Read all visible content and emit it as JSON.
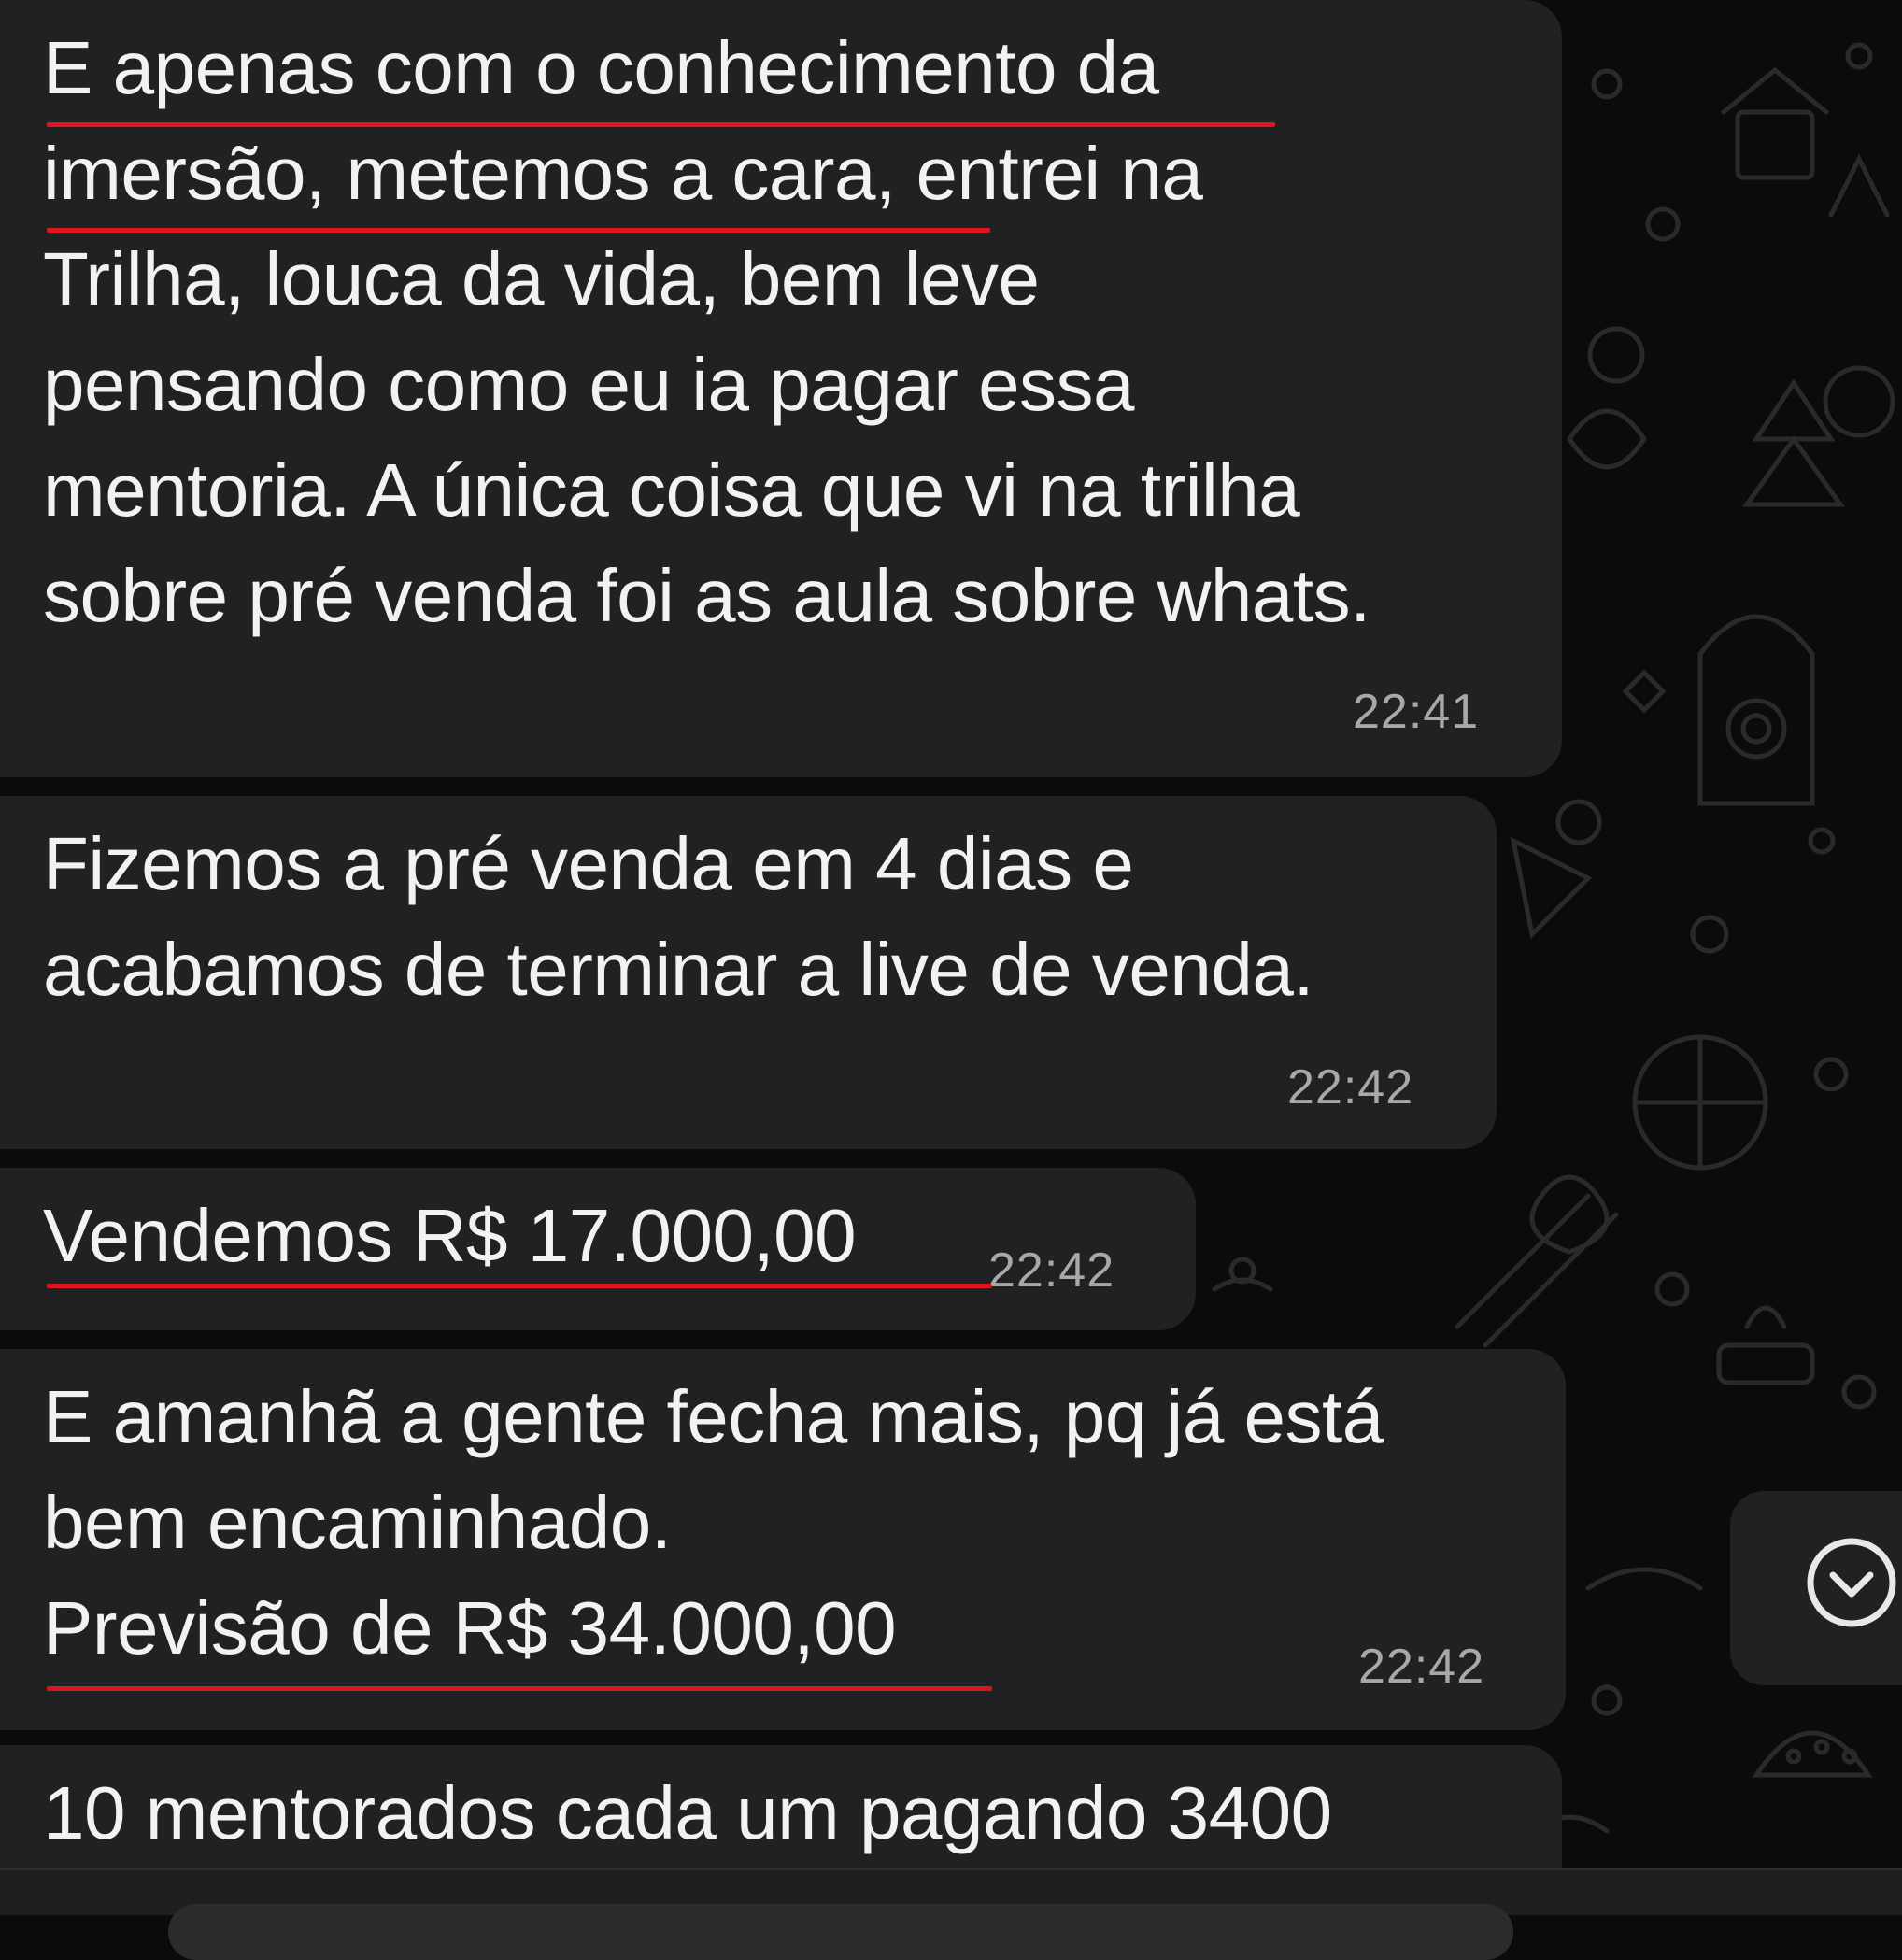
{
  "messages": [
    {
      "text": "E apenas com o conhecimento da\nimersão, metemos a cara, entrei na\nTrilha, louca da vida, bem leve\npensando como eu ia pagar essa\nmentoria. A única coisa que vi na trilha\nsobre pré venda foi as aula sobre whats.",
      "time": "22:41"
    },
    {
      "text": "Fizemos a pré venda em 4 dias e\nacabamos de terminar a live de venda.",
      "time": "22:42"
    },
    {
      "text": "Vendemos R$ 17.000,00",
      "time": "22:42"
    },
    {
      "text": "E amanhã a gente fecha mais, pq já está\nbem encaminhado.\nPrevisão de R$ 34.000,00",
      "time": "22:42"
    },
    {
      "text": "10 mentorados cada um pagando 3400",
      "time": ""
    }
  ],
  "scroll_down_icon": "chevron-down-circle-icon",
  "colors": {
    "bubble": "#202123",
    "background": "#0b0b0b",
    "text": "#f2f2f2",
    "timestamp": "#a7a8aa",
    "highlight_underline": "#e0141f"
  }
}
